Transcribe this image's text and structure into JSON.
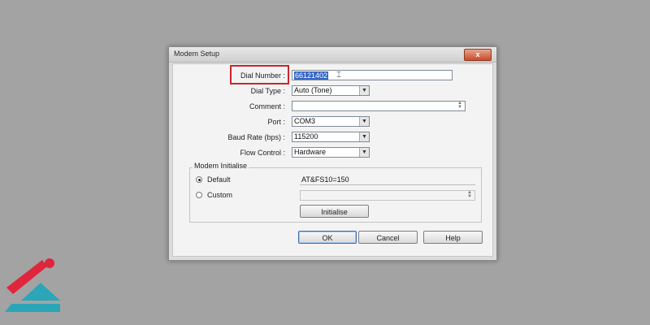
{
  "dialog": {
    "title": "Modem Setup",
    "close_glyph": "x"
  },
  "form": {
    "dial_number_label": "Dial Number :",
    "dial_number_value": "66121402",
    "dial_type_label": "Dial Type :",
    "dial_type_value": "Auto (Tone)",
    "comment_label": "Comment :",
    "comment_value": "",
    "port_label": "Port :",
    "port_value": "COM3",
    "baud_label": "Baud Rate (bps) :",
    "baud_value": "115200",
    "flow_label": "Flow Control :",
    "flow_value": "Hardware"
  },
  "modem_init": {
    "group_title": "Modem Initialise",
    "default_label": "Default",
    "default_value": "AT&FS10=150",
    "custom_label": "Custom",
    "custom_value": "",
    "initialise_button": "Initialise",
    "selected": "Default"
  },
  "buttons": {
    "ok": "OK",
    "cancel": "Cancel",
    "help": "Help"
  },
  "colors": {
    "highlight_box": "#c8262c",
    "logo_red": "#e0263c",
    "logo_teal": "#2aa6b8"
  },
  "icons": {
    "text_cursor": "I-beam-icon",
    "combo_arrow": "chevron-down-icon",
    "logo": "brand-logo"
  }
}
